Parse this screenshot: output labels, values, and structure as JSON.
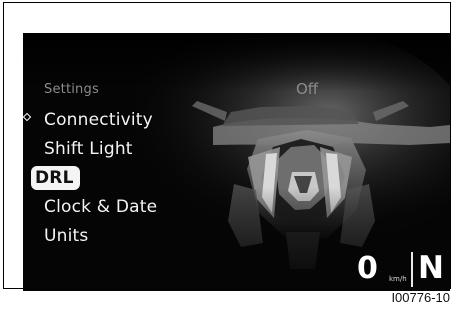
{
  "settings_menu": {
    "title": "Settings",
    "items": [
      {
        "label": "Connectivity",
        "selected": false
      },
      {
        "label": "Shift Light",
        "selected": false
      },
      {
        "label": "DRL",
        "selected": true
      },
      {
        "label": "Clock & Date",
        "selected": false
      },
      {
        "label": "Units",
        "selected": false
      }
    ]
  },
  "selected_setting": {
    "value": "Off"
  },
  "status": {
    "speed": "0",
    "speed_unit": "km/h",
    "gear": "N"
  },
  "figure": {
    "code": "I00776-10"
  },
  "icons": {
    "selection_marker": "diamond-icon"
  },
  "colors": {
    "screen_background": "#050505",
    "primary_text": "#f4f4f4",
    "secondary_text": "#8b8b8b",
    "selection_background": "#f4f4f4",
    "selection_text": "#111111"
  }
}
